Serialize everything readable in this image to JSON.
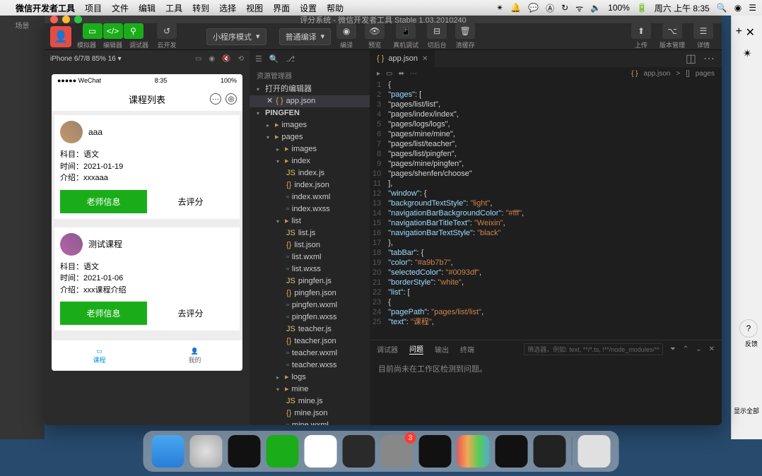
{
  "menubar": {
    "app": "微信开发者工具",
    "items": [
      "项目",
      "文件",
      "编辑",
      "工具",
      "转到",
      "选择",
      "视图",
      "界面",
      "设置",
      "帮助"
    ],
    "status": {
      "battery": "100%",
      "day": "周六 上午 8:35"
    }
  },
  "window": {
    "title": "评分系统 - 微信开发者工具 Stable 1.03.2010240"
  },
  "toolbar": {
    "groups": {
      "sim": "模拟器",
      "editor": "编辑器",
      "debugger": "调试器",
      "cloud": "云开发",
      "compile": "编译",
      "preview": "预览",
      "remote": "真机调试",
      "cut": "切后台",
      "clear": "清缓存",
      "upload": "上传",
      "version": "版本管理",
      "detail": "详情"
    },
    "mode": "小程序模式",
    "compile_mode": "普通编译"
  },
  "sim": {
    "device": "iPhone 6/7/8 85% 16 ▾",
    "status_left": "●●●●● WeChat",
    "status_time": "8:35",
    "status_right": "100%",
    "nav_title": "课程列表",
    "cards": [
      {
        "title": "aaa",
        "subject": "科目：语文",
        "time": "时间：2021-01-19",
        "intro": "介绍：xxxaaa"
      },
      {
        "title": "测试课程",
        "subject": "科目：语文",
        "time": "时间：2021-01-06",
        "intro": "介绍：xxx课程介绍"
      }
    ],
    "btn_primary": "老师信息",
    "btn_secondary": "去评分",
    "tabs": [
      "课程",
      "我的"
    ]
  },
  "explorer": {
    "title": "资源管理器",
    "open_editors": "打开的编辑器",
    "open_file": "app.json",
    "root": "PINGFEN",
    "tree": {
      "images": "images",
      "pages": "pages",
      "index": "index",
      "list": "list",
      "index_js": "index.js",
      "index_json": "index.json",
      "index_wxml": "index.wxml",
      "index_wxss": "index.wxss",
      "list_js": "list.js",
      "list_json": "list.json",
      "list_wxml": "list.wxml",
      "list_wxss": "list.wxss",
      "pingfen_js": "pingfen.js",
      "pingfen_json": "pingfen.json",
      "pingfen_wxml": "pingfen.wxml",
      "pingfen_wxss": "pingfen.wxss",
      "teacher_js": "teacher.js",
      "teacher_json": "teacher.json",
      "teacher_wxml": "teacher.wxml",
      "teacher_wxss": "teacher.wxss",
      "logs": "logs",
      "mine": "mine",
      "mine_js": "mine.js",
      "mine_json": "mine.json",
      "mine_wxml": "mine.wxml"
    }
  },
  "editor": {
    "tab": "app.json",
    "breadcrumb": [
      "{}",
      "app.json",
      ">",
      "[]",
      "pages"
    ],
    "lines": [
      "{",
      "  \"pages\": [",
      "    \"pages/list/list\",",
      "    \"pages/index/index\",",
      "    \"pages/logs/logs\",",
      "    \"pages/mine/mine\",",
      "    \"pages/list/teacher\",",
      "    \"pages/list/pingfen\",",
      "    \"pages/mine/pingfen\",",
      "    \"pages/shenfen/choose\"",
      "  ],",
      "  \"window\": {",
      "    \"backgroundTextStyle\": \"light\",",
      "    \"navigationBarBackgroundColor\": \"#fff\",",
      "    \"navigationBarTitleText\": \"Weixin\",",
      "    \"navigationBarTextStyle\": \"black\"",
      "  },",
      "  \"tabBar\": {",
      "    \"color\": \"#a9b7b7\",",
      "    \"selectedColor\": \"#0093df\",",
      "    \"borderStyle\": \"white\",",
      "    \"list\": [",
      "      {",
      "        \"pagePath\": \"pages/list/list\",",
      "        \"text\": \"课程\","
    ]
  },
  "problems": {
    "tabs": [
      "调试器",
      "问题",
      "输出",
      "终端"
    ],
    "filter_placeholder": "筛选器，例如: text, **/*.ts, !**/node_modules/**",
    "message": "目前尚未在工作区检测到问题。"
  },
  "browser": {
    "feedback": "反馈",
    "show_all": "显示全部"
  },
  "left_panel": {
    "scene": "场景"
  },
  "dock_badge": "3"
}
